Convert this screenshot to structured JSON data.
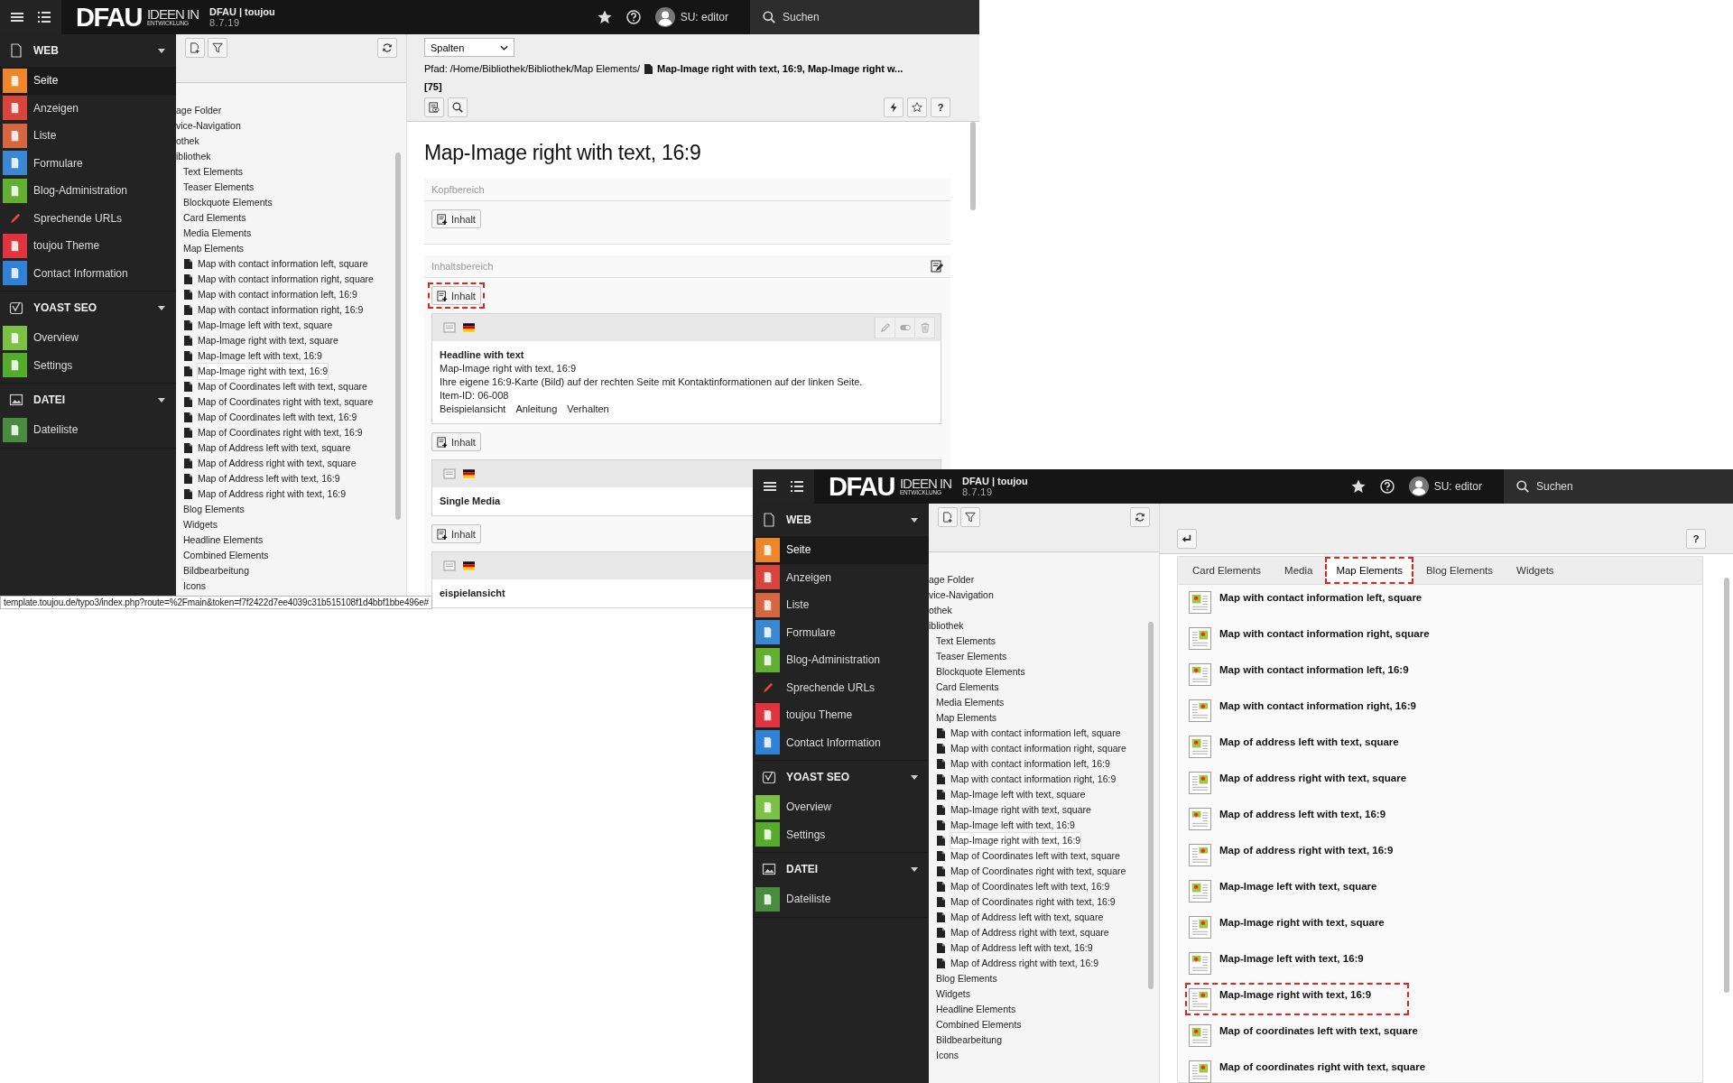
{
  "windows": [
    {
      "kind": "page-module",
      "topbar": {
        "logo": "DFAU",
        "logo_top": "IDEEN IN",
        "logo_bottom": "ENTWICKLUNG",
        "site": "DFAU | toujou",
        "version": "8.7.19",
        "user": "SU: editor",
        "search": "Suchen"
      },
      "modules": [
        {
          "label": "WEB",
          "expanded": true,
          "items": [
            {
              "label": "Seite",
              "color": "#f0862a",
              "selected": true
            },
            {
              "label": "Anzeigen",
              "color": "#d9453c",
              "selected": false
            },
            {
              "label": "Liste",
              "color": "#d6663f",
              "selected": false
            },
            {
              "label": "Formulare",
              "color": "#3a87d4",
              "selected": false
            },
            {
              "label": "Blog-Administration",
              "color": "#62b030",
              "selected": false
            },
            {
              "label": "Sprechende URLs",
              "selected": false
            },
            {
              "label": "toujou Theme",
              "color": "#e0353e",
              "selected": false
            },
            {
              "label": "Contact Information",
              "color": "#2f82d6",
              "selected": false
            }
          ]
        },
        {
          "label": "YOAST SEO",
          "expanded": true,
          "items": [
            {
              "label": "Overview",
              "color": "#7bc143",
              "selected": false
            },
            {
              "label": "Settings",
              "color": "#55ab2a",
              "selected": false
            }
          ]
        },
        {
          "label": "DATEI",
          "expanded": true,
          "items": [
            {
              "label": "Dateiliste",
              "color": "#4a8c3f",
              "selected": false
            }
          ]
        }
      ],
      "tree": [
        {
          "label": "age Folder",
          "selected": false
        },
        {
          "label": "vice-Navigation",
          "selected": false
        },
        {
          "label": "othek",
          "selected": false
        },
        {
          "label": "ibliothek",
          "selected": false,
          "children": [
            {
              "label": "Text Elements",
              "selected": false
            },
            {
              "label": "Teaser Elements",
              "selected": false
            },
            {
              "label": "Blockquote Elements",
              "selected": false
            },
            {
              "label": "Card Elements",
              "selected": false
            },
            {
              "label": "Media Elements",
              "selected": false
            },
            {
              "label": "Map Elements",
              "selected": false,
              "children": [
                {
                  "label": "Map with contact information left, square",
                  "selected": false
                },
                {
                  "label": "Map with contact information right, square",
                  "selected": false
                },
                {
                  "label": "Map with contact information left, 16:9",
                  "selected": false
                },
                {
                  "label": "Map with contact information right, 16:9",
                  "selected": false
                },
                {
                  "label": "Map-Image left with text, square",
                  "selected": false
                },
                {
                  "label": "Map-Image right with text, square",
                  "selected": false
                },
                {
                  "label": "Map-Image left with text, 16:9",
                  "selected": false
                },
                {
                  "label": "Map-Image right with text, 16:9",
                  "selected": true
                },
                {
                  "label": "Map of Coordinates left with text, square",
                  "selected": false
                },
                {
                  "label": "Map of Coordinates right with text, square",
                  "selected": false
                },
                {
                  "label": "Map of Coordinates left with text, 16:9",
                  "selected": false
                },
                {
                  "label": "Map of Coordinates right with text, 16:9",
                  "selected": false
                },
                {
                  "label": "Map of Address left with text, square",
                  "selected": false
                },
                {
                  "label": "Map of Address right with text, square",
                  "selected": false
                },
                {
                  "label": "Map of Address left with text, 16:9",
                  "selected": false
                },
                {
                  "label": "Map of Address right with text, 16:9",
                  "selected": false
                }
              ]
            },
            {
              "label": "Blog Elements",
              "selected": false
            },
            {
              "label": "Widgets",
              "selected": false
            },
            {
              "label": "Headline Elements",
              "selected": false
            },
            {
              "label": "Combined Elements",
              "selected": false
            },
            {
              "label": "Bildbearbeitung",
              "selected": false
            },
            {
              "label": "Icons",
              "selected": false
            }
          ]
        }
      ],
      "page": {
        "view_select": "Spalten",
        "path_label": "Pfad: /Home/Bibliothek/Bibliothek/Map Elements/",
        "path_page": "Map-Image right with text, 16:9, Map-Image right w...",
        "page_id": "[75]",
        "help": "?",
        "title": "Map-Image right with text, 16:9",
        "sections": [
          {
            "label": "Kopfbereich",
            "editable": false,
            "rows": [
              {
                "kind": "add",
                "label": "Inhalt",
                "highlighted": false
              }
            ]
          },
          {
            "label": "Inhaltsbereich",
            "editable": true,
            "rows": [
              {
                "kind": "add",
                "label": "Inhalt",
                "highlighted": true
              },
              {
                "kind": "element",
                "title": "Headline with text",
                "actions": true,
                "lines": [
                  "Map-Image right with text, 16:9",
                  "Ihre eigene 16:9-Karte (Bild) auf der rechten Seite mit Kontaktinformationen auf der linken Seite.",
                  "Item-ID: 06-008"
                ],
                "links": [
                  "Beispielansicht",
                  "Anleitung",
                  "Verhalten"
                ]
              },
              {
                "kind": "add",
                "label": "Inhalt",
                "highlighted": false
              },
              {
                "kind": "element",
                "title": "Single Media"
              },
              {
                "kind": "add",
                "label": "Inhalt",
                "highlighted": false
              },
              {
                "kind": "element",
                "title": "eispielansicht"
              }
            ]
          }
        ]
      },
      "status_bar": "template.toujou.de/typo3/index.php?route=%2Fmain&token=f7f2422d7ee4039c31b515108f1d4bbf1bbe496e#"
    },
    {
      "kind": "new-content-wizard",
      "topbar": {
        "logo": "DFAU",
        "logo_top": "IDEEN IN",
        "logo_bottom": "ENTWICKLUNG",
        "site": "DFAU | toujou",
        "version": "8.7.19",
        "user": "SU: editor",
        "search": "Suchen"
      },
      "modules": [
        {
          "label": "WEB",
          "expanded": true,
          "items": [
            {
              "label": "Seite",
              "color": "#f0862a",
              "selected": true
            },
            {
              "label": "Anzeigen",
              "color": "#d9453c",
              "selected": false
            },
            {
              "label": "Liste",
              "color": "#d6663f",
              "selected": false
            },
            {
              "label": "Formulare",
              "color": "#3a87d4",
              "selected": false
            },
            {
              "label": "Blog-Administration",
              "color": "#62b030",
              "selected": false
            },
            {
              "label": "Sprechende URLs",
              "selected": false
            },
            {
              "label": "toujou Theme",
              "color": "#e0353e",
              "selected": false
            },
            {
              "label": "Contact Information",
              "color": "#2f82d6",
              "selected": false
            }
          ]
        },
        {
          "label": "YOAST SEO",
          "expanded": true,
          "items": [
            {
              "label": "Overview",
              "color": "#7bc143",
              "selected": false
            },
            {
              "label": "Settings",
              "color": "#55ab2a",
              "selected": false
            }
          ]
        },
        {
          "label": "DATEI",
          "expanded": true,
          "items": [
            {
              "label": "Dateiliste",
              "color": "#4a8c3f",
              "selected": false
            }
          ]
        }
      ],
      "tree": [
        {
          "label": "age Folder",
          "selected": false
        },
        {
          "label": "vice-Navigation",
          "selected": false
        },
        {
          "label": "othek",
          "selected": false
        },
        {
          "label": "ibliothek",
          "selected": false,
          "children": [
            {
              "label": "Text Elements",
              "selected": false
            },
            {
              "label": "Teaser Elements",
              "selected": false
            },
            {
              "label": "Blockquote Elements",
              "selected": false
            },
            {
              "label": "Card Elements",
              "selected": false
            },
            {
              "label": "Media Elements",
              "selected": false
            },
            {
              "label": "Map Elements",
              "selected": false,
              "children": [
                {
                  "label": "Map with contact information left, square",
                  "selected": false
                },
                {
                  "label": "Map with contact information right, square",
                  "selected": false
                },
                {
                  "label": "Map with contact information left, 16:9",
                  "selected": false
                },
                {
                  "label": "Map with contact information right, 16:9",
                  "selected": false
                },
                {
                  "label": "Map-Image left with text, square",
                  "selected": false
                },
                {
                  "label": "Map-Image right with text, square",
                  "selected": false
                },
                {
                  "label": "Map-Image left with text, 16:9",
                  "selected": false
                },
                {
                  "label": "Map-Image right with text, 16:9",
                  "selected": true
                },
                {
                  "label": "Map of Coordinates left with text, square",
                  "selected": false
                },
                {
                  "label": "Map of Coordinates right with text, square",
                  "selected": false
                },
                {
                  "label": "Map of Coordinates left with text, 16:9",
                  "selected": false
                },
                {
                  "label": "Map of Coordinates right with text, 16:9",
                  "selected": false
                },
                {
                  "label": "Map of Address left with text, square",
                  "selected": false
                },
                {
                  "label": "Map of Address right with text, square",
                  "selected": false
                },
                {
                  "label": "Map of Address left with text, 16:9",
                  "selected": false
                },
                {
                  "label": "Map of Address right with text, 16:9",
                  "selected": false
                }
              ]
            },
            {
              "label": "Blog Elements",
              "selected": false
            },
            {
              "label": "Widgets",
              "selected": false
            },
            {
              "label": "Headline Elements",
              "selected": false
            },
            {
              "label": "Combined Elements",
              "selected": false
            },
            {
              "label": "Bildbearbeitung",
              "selected": false
            },
            {
              "label": "Icons",
              "selected": false
            }
          ]
        }
      ],
      "wizard": {
        "help": "?",
        "tabs": [
          {
            "label": "Card Elements",
            "selected": false,
            "highlighted": false
          },
          {
            "label": "Media",
            "selected": false,
            "highlighted": false
          },
          {
            "label": "Map Elements",
            "selected": true,
            "highlighted": true
          },
          {
            "label": "Blog Elements",
            "selected": false,
            "highlighted": false
          },
          {
            "label": "Widgets",
            "selected": false,
            "highlighted": false
          }
        ],
        "items": [
          {
            "label": "Map with contact information left, square",
            "highlighted": false
          },
          {
            "label": "Map with contact information right, square",
            "highlighted": false
          },
          {
            "label": "Map with contact information left, 16:9",
            "highlighted": false
          },
          {
            "label": "Map with contact information right, 16:9",
            "highlighted": false
          },
          {
            "label": "Map of address left with text, square",
            "highlighted": false
          },
          {
            "label": "Map of address right with text, square",
            "highlighted": false
          },
          {
            "label": "Map of address left with text, 16:9",
            "highlighted": false
          },
          {
            "label": "Map of address right with text, 16:9",
            "highlighted": false
          },
          {
            "label": "Map-Image left with text, square",
            "highlighted": false
          },
          {
            "label": "Map-Image right with text, square",
            "highlighted": false
          },
          {
            "label": "Map-Image left with text, 16:9",
            "highlighted": false
          },
          {
            "label": "Map-Image right with text, 16:9",
            "highlighted": true
          },
          {
            "label": "Map of coordinates left with text, square",
            "highlighted": false
          },
          {
            "label": "Map of coordinates right with text, square",
            "highlighted": false
          }
        ]
      }
    }
  ]
}
